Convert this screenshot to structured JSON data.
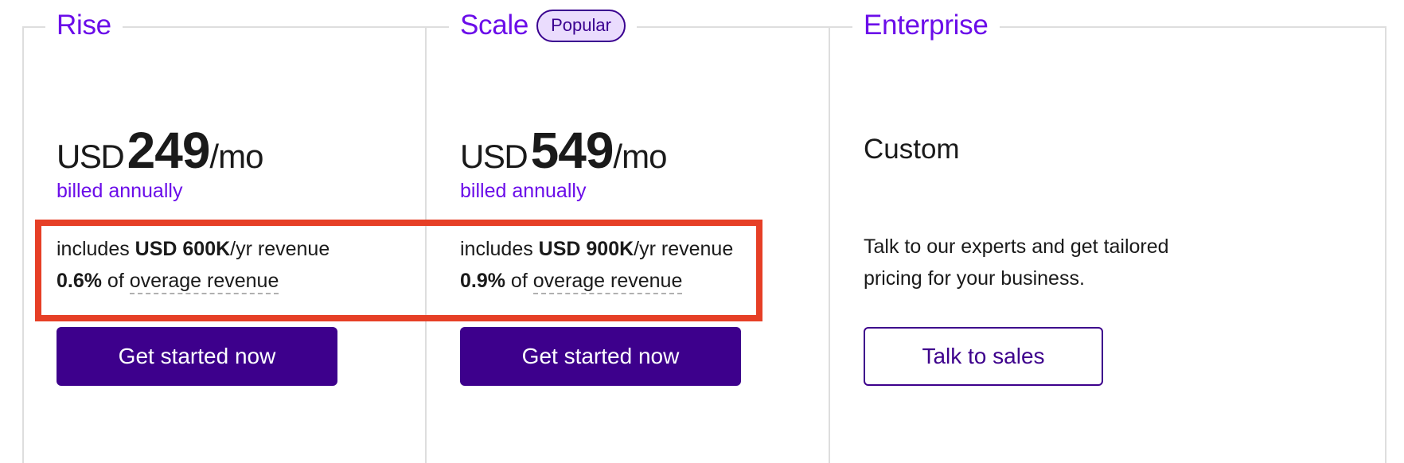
{
  "plans": [
    {
      "name": "Rise",
      "price": {
        "currency": "USD",
        "amount": "249",
        "period": "/mo"
      },
      "billing": "billed annually",
      "includes": {
        "prefix": "includes ",
        "amount": "USD 600K",
        "suffix": "/yr revenue"
      },
      "overage": {
        "rate": "0.6%",
        "middle": " of ",
        "link": "overage revenue"
      },
      "cta": "Get started now"
    },
    {
      "name": "Scale",
      "badge": "Popular",
      "price": {
        "currency": "USD",
        "amount": "549",
        "period": "/mo"
      },
      "billing": "billed annually",
      "includes": {
        "prefix": "includes ",
        "amount": "USD 900K",
        "suffix": "/yr revenue"
      },
      "overage": {
        "rate": "0.9%",
        "middle": " of ",
        "link": "overage revenue"
      },
      "cta": "Get started now"
    },
    {
      "name": "Enterprise",
      "price_label": "Custom",
      "description": "Talk to our experts and get tailored pricing for your business.",
      "cta": "Talk to sales"
    }
  ],
  "colors": {
    "accent_purple": "#6b0de9",
    "button_purple": "#3d008c",
    "badge_bg": "#eadcfd",
    "highlight_red": "#e63f26",
    "border_gray": "#dedede"
  }
}
